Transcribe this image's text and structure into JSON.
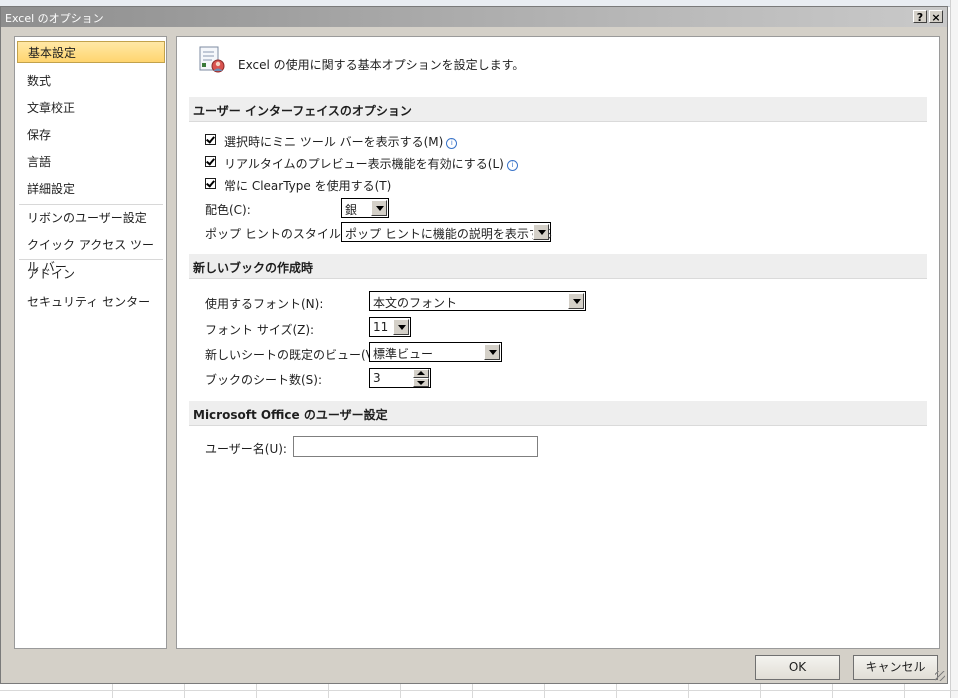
{
  "window": {
    "title": "Excel のオプション",
    "help_button": "?",
    "close_button": "×"
  },
  "nav": {
    "items": [
      {
        "label": "基本設定",
        "active": true
      },
      {
        "label": "数式"
      },
      {
        "label": "文章校正"
      },
      {
        "label": "保存"
      },
      {
        "label": "言語"
      },
      {
        "label": "詳細設定"
      },
      {
        "label": "リボンのユーザー設定"
      },
      {
        "label": "クイック アクセス ツール バー"
      },
      {
        "label": "アドイン"
      },
      {
        "label": "セキュリティ センター"
      }
    ]
  },
  "main": {
    "header_text": "Excel の使用に関する基本オプションを設定します。",
    "header_icon": "options-icon",
    "sections": [
      {
        "title": "ユーザー インターフェイスのオプション"
      },
      {
        "title": "新しいブックの作成時"
      },
      {
        "title": "Microsoft Office のユーザー設定"
      }
    ],
    "ui_options": {
      "mini_toolbar": {
        "label": "選択時にミニ ツール バーを表示する(M)",
        "checked": true
      },
      "live_preview": {
        "label": "リアルタイムのプレビュー表示機能を有効にする(L)",
        "checked": true
      },
      "cleartype": {
        "label": "常に ClearType を使用する(T)",
        "checked": true
      },
      "color_scheme": {
        "label": "配色(C):",
        "value": "銀"
      },
      "screentip_style": {
        "label": "ポップ ヒントのスタイル(R):",
        "value": "ポップ ヒントに機能の説明を表示する"
      }
    },
    "new_workbook": {
      "font": {
        "label": "使用するフォント(N):",
        "value": "本文のフォント"
      },
      "font_size": {
        "label": "フォント サイズ(Z):",
        "value": "11"
      },
      "default_view": {
        "label": "新しいシートの既定のビュー(V):",
        "value": "標準ビュー"
      },
      "sheet_count": {
        "label": "ブックのシート数(S):",
        "value": "3"
      }
    },
    "office_user": {
      "username": {
        "label": "ユーザー名(U):",
        "value": ""
      }
    }
  },
  "footer": {
    "ok_label": "OK",
    "cancel_label": "キャンセル"
  },
  "colors": {
    "nav_active_bg": "#ffd56f",
    "section_bg": "#eeeeee",
    "dialog_bg": "#d4d0c8",
    "info_icon": "#3a74c9"
  }
}
